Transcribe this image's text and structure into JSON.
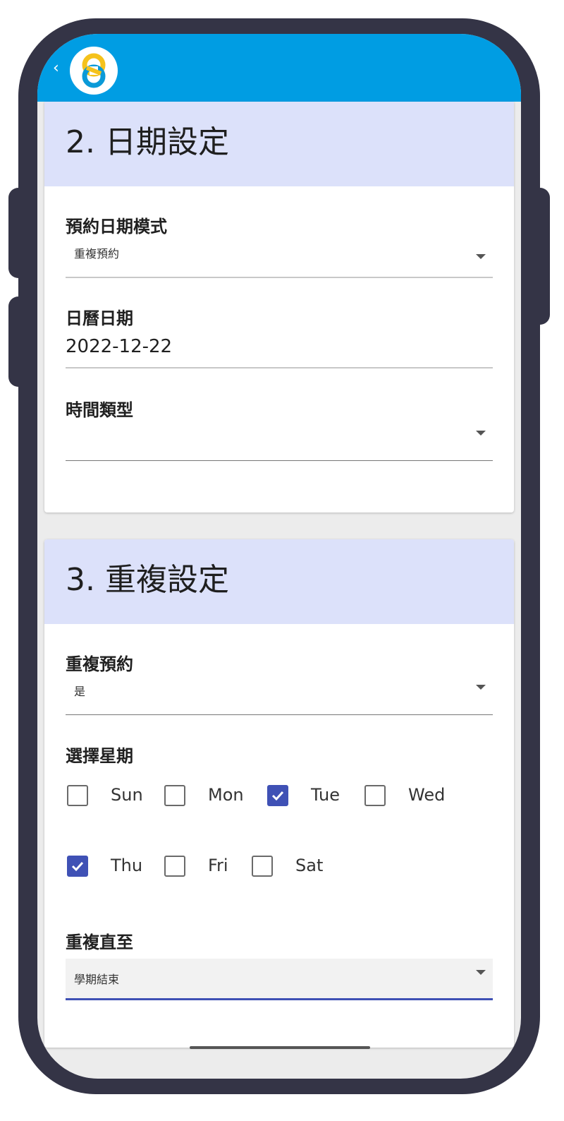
{
  "app_bar": {
    "back_label": "‹",
    "logo_icon": "app-logo-icon",
    "background": "#009de3"
  },
  "section_date": {
    "title": "2. 日期設定",
    "mode": {
      "label": "預約日期模式",
      "value": "重複預約"
    },
    "calendar_date": {
      "label": "日曆日期",
      "value": "2022-12-22"
    },
    "time_type": {
      "label": "時間類型",
      "value": ""
    }
  },
  "section_repeat": {
    "title": "3. 重複設定",
    "repeat": {
      "label": "重複預約",
      "value": "是"
    },
    "weekday_label": "選擇星期",
    "weekdays": [
      {
        "label": "Sun",
        "checked": false
      },
      {
        "label": "Mon",
        "checked": false
      },
      {
        "label": "Tue",
        "checked": true
      },
      {
        "label": "Wed",
        "checked": false
      },
      {
        "label": "Thu",
        "checked": true
      },
      {
        "label": "Fri",
        "checked": false
      },
      {
        "label": "Sat",
        "checked": false
      }
    ],
    "until": {
      "label": "重複直至",
      "value": "學期結束"
    }
  },
  "colors": {
    "header_band": "#dce1fa",
    "accent": "#3f51b5",
    "frame": "#343446"
  }
}
